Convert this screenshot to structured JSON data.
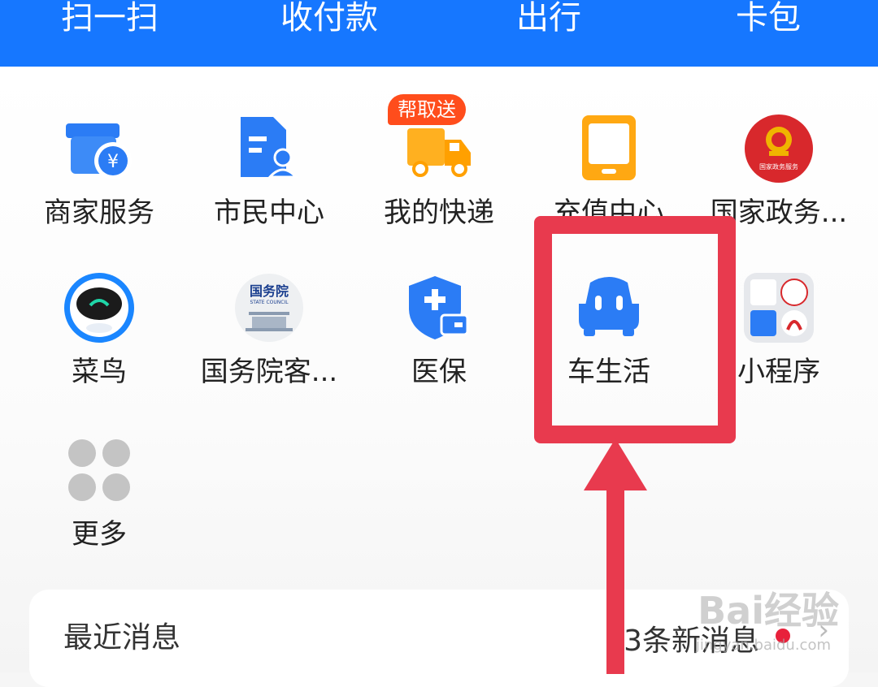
{
  "top_actions": [
    "扫一扫",
    "收付款",
    "出行",
    "卡包"
  ],
  "apps_row1": [
    {
      "label": "商家服务",
      "icon": "merchant-shop-icon"
    },
    {
      "label": "市民中心",
      "icon": "citizen-center-icon"
    },
    {
      "label": "我的快递",
      "icon": "delivery-truck-icon",
      "badge": "帮取送"
    },
    {
      "label": "充值中心",
      "icon": "phone-recharge-icon"
    },
    {
      "label": "国家政务...",
      "icon": "national-emblem-icon",
      "icon_text": "国家政务服务"
    }
  ],
  "apps_row2": [
    {
      "label": "菜鸟",
      "icon": "cainiao-robot-icon"
    },
    {
      "label": "国务院客...",
      "icon": "state-council-icon",
      "icon_text": "国务院",
      "icon_subtext": "STATE COUNCIL"
    },
    {
      "label": "医保",
      "icon": "medical-insurance-icon"
    },
    {
      "label": "车生活",
      "icon": "car-life-icon"
    },
    {
      "label": "小程序",
      "icon": "mini-program-icon"
    }
  ],
  "apps_row3": [
    {
      "label": "更多",
      "icon": "more-grid-icon"
    }
  ],
  "messages": {
    "title": "最近消息",
    "count_text": "3条新消息"
  },
  "watermark": {
    "text": "Bai经验",
    "sub": "jingyan.baidu.com"
  },
  "colors": {
    "primary": "#1677ff",
    "highlight": "#e83a4e",
    "badge": "#ff4d1c",
    "dot": "#e8213b"
  }
}
